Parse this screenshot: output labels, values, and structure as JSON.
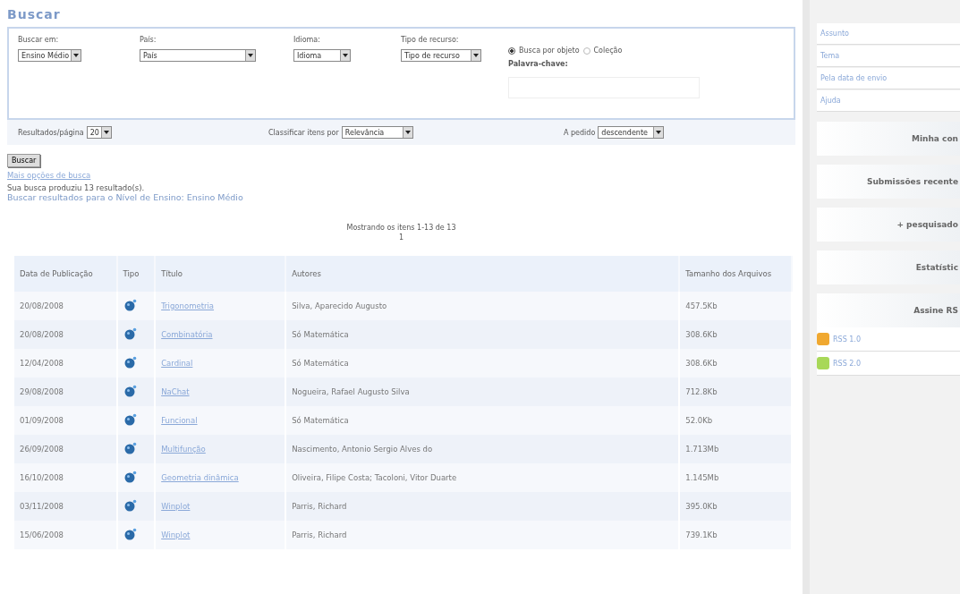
{
  "page_title": "Buscar",
  "filters": [
    {
      "label": "Buscar em:",
      "value": "Ensino Médio"
    },
    {
      "label": "País:",
      "value": "País"
    },
    {
      "label": "Idioma:",
      "value": "Idioma"
    },
    {
      "label": "Tipo de recurso:",
      "value": "Tipo de recurso"
    }
  ],
  "search_modes": [
    {
      "label": "Busca por objeto",
      "selected": true
    },
    {
      "label": "Coleção",
      "selected": false
    }
  ],
  "keyword": {
    "label": "Palavra-chave:"
  },
  "options": [
    {
      "label": "Resultados/página",
      "value": "20"
    },
    {
      "label": "Classificar itens por",
      "value": "Relevância"
    },
    {
      "label": "A pedido",
      "value": "descendente"
    }
  ],
  "search_button": "Buscar",
  "more_options_link": "Mais opções de busca",
  "result_summary": "Sua busca produziu 13 resultado(s).",
  "level_link": "Buscar resultados para o Nível de Ensino: Ensino Médio",
  "pagination": {
    "showing": "Mostrando os itens 1-13 de 13",
    "page": "1"
  },
  "table": {
    "columns": [
      "Data de Publicação",
      "Tipo",
      "Título",
      "Autores",
      "Tamanho dos Arquivos"
    ],
    "rows": [
      {
        "date": "20/08/2008",
        "title": "Trigonometria",
        "authors": "Silva, Aparecido Augusto",
        "size": "457.5Kb"
      },
      {
        "date": "20/08/2008",
        "title": "Combinatória",
        "authors": "Só Matemática",
        "size": "308.6Kb"
      },
      {
        "date": "12/04/2008",
        "title": "Cardinal",
        "authors": "Só Matemática",
        "size": "308.6Kb"
      },
      {
        "date": "29/08/2008",
        "title": "NaChat",
        "authors": "Nogueira, Rafael Augusto Silva",
        "size": "712.8Kb"
      },
      {
        "date": "01/09/2008",
        "title": "Funcional",
        "authors": "Só Matemática",
        "size": "52.0Kb"
      },
      {
        "date": "26/09/2008",
        "title": "Multifunção",
        "authors": "Nascimento, Antonio Sergio Alves do",
        "size": "1.713Mb"
      },
      {
        "date": "16/10/2008",
        "title": "Geometria dinâmica",
        "authors": "Oliveira, Filipe Costa; Tacoloni, Vitor Duarte",
        "size": "1.145Mb"
      },
      {
        "date": "03/11/2008",
        "title": "Winplot",
        "authors": "Parris, Richard",
        "size": "395.0Kb"
      },
      {
        "date": "15/06/2008",
        "title": "Winplot",
        "authors": "Parris, Richard",
        "size": "739.1Kb"
      }
    ]
  },
  "sidebar": {
    "links": [
      "Assunto",
      "Tema",
      "Pela data de envio",
      "Ajuda"
    ],
    "panels": [
      "Minha con",
      "Submissões recente",
      "+ pesquisado",
      "Estatístic",
      "Assine RS"
    ],
    "feeds": [
      {
        "label": "RSS 1.0",
        "color": "#f0a830"
      },
      {
        "label": "RSS 2.0",
        "color": "#a8d858"
      }
    ]
  }
}
